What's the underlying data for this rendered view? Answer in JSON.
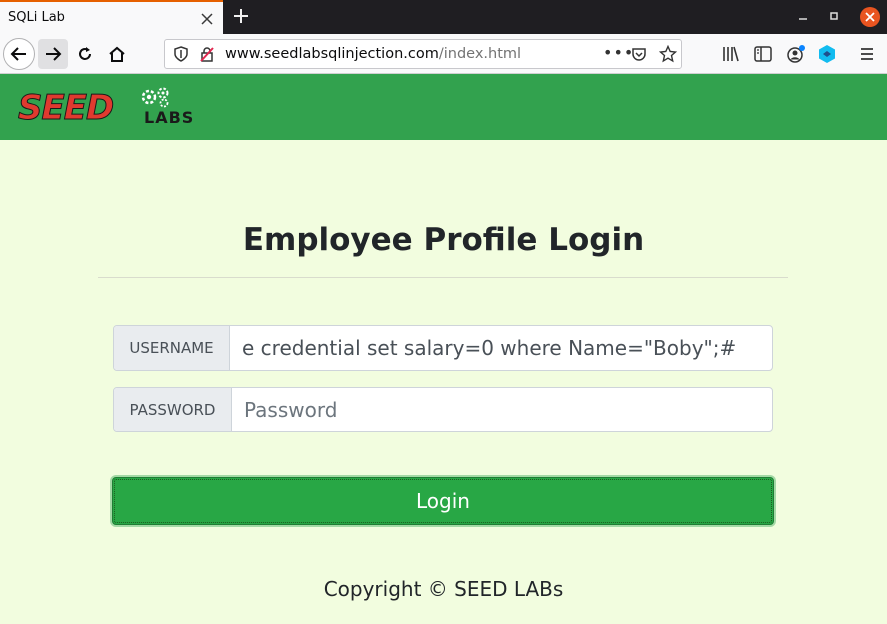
{
  "browser": {
    "tab_title": "SQLi Lab",
    "tab_close_icon": "close-icon",
    "new_tab_icon": "plus-icon",
    "url_host": "www.seedlabsqlinjection.com",
    "url_path": "/index.html",
    "page_actions_label": "•••"
  },
  "header": {
    "logo_seed": "SEED",
    "logo_labs": "LABS",
    "background": "#32a24e"
  },
  "main": {
    "title": "Employee Profile Login",
    "username_label": "USERNAME",
    "username_value": "e credential set salary=0 where Name=\"Boby\";#",
    "password_label": "PASSWORD",
    "password_placeholder": "Password",
    "login_label": "Login",
    "button_color": "#28a745"
  },
  "footer": {
    "copyright": "Copyright © SEED LABs"
  }
}
